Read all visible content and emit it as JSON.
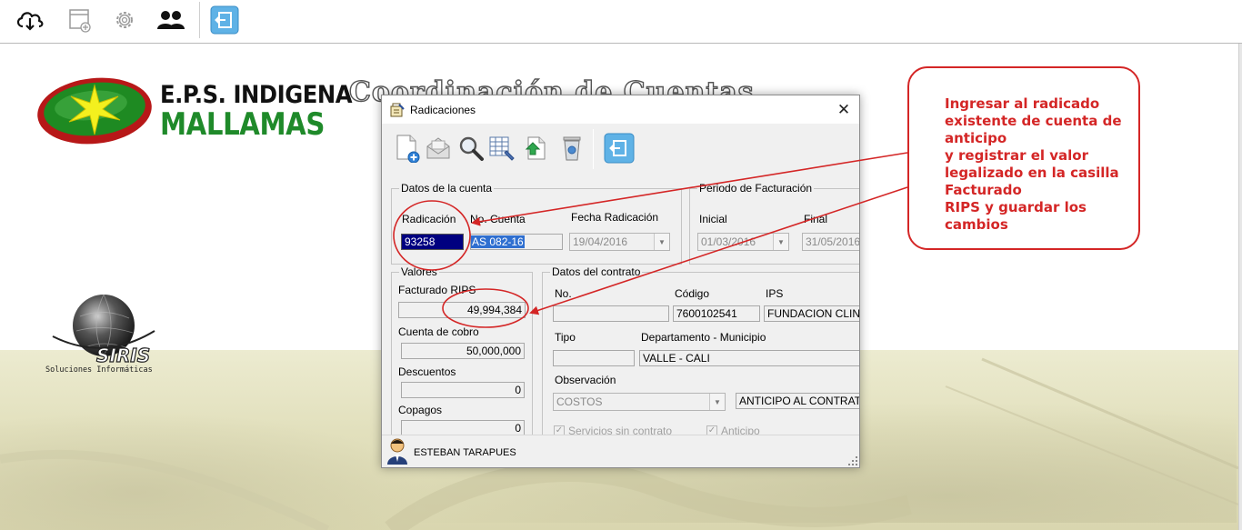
{
  "toolbar": {
    "buttons": [
      "cloud-download-icon",
      "new-window-icon",
      "settings-icon",
      "users-icon",
      "exit-icon"
    ]
  },
  "logo": {
    "line1": "E.P.S. INDIGENA",
    "line2": "MALLAMAS"
  },
  "background_title": "Coordinación de Cuentas",
  "siris": {
    "name": "SIRIS",
    "tagline": "Soluciones Informáticas"
  },
  "dialog": {
    "title": "Radicaciones",
    "close_label": "✕",
    "toolbar_icons": [
      "new-document-icon",
      "open-mail-icon",
      "search-icon",
      "grid-edit-icon",
      "export-icon",
      "delete-icon",
      "exit-icon"
    ],
    "datos_cuenta": {
      "group_label": "Datos de la cuenta",
      "radicacion_label": "Radicación",
      "radicacion_value": "93258",
      "no_cuenta_label": "No. Cuenta",
      "no_cuenta_value": "AS 082-16",
      "fecha_label": "Fecha Radicación",
      "fecha_value": "19/04/2016"
    },
    "periodo": {
      "group_label": "Periodo de Facturación",
      "inicial_label": "Inicial",
      "inicial_value": "01/03/2016",
      "final_label": "Final",
      "final_value": "31/05/2016"
    },
    "valores": {
      "group_label": "Valores",
      "facturado_label": "Facturado RIPS",
      "facturado_value": "49,994,384",
      "cuenta_cobro_label": "Cuenta de cobro",
      "cuenta_cobro_value": "50,000,000",
      "descuentos_label": "Descuentos",
      "descuentos_value": "0",
      "copagos_label": "Copagos",
      "copagos_value": "0"
    },
    "contrato": {
      "group_label": "Datos del contrato",
      "no_label": "No.",
      "no_value": "",
      "codigo_label": "Código",
      "codigo_value": "7600102541",
      "ips_label": "IPS",
      "ips_value": "FUNDACION CLINICA",
      "tipo_label": "Tipo",
      "tipo_value": "",
      "depto_label": "Departamento - Municipio",
      "depto_value": "VALLE - CALI",
      "observacion_label": "Observación",
      "observacion_combo": "COSTOS",
      "observacion_value": "ANTICIPO AL CONTRATO",
      "chk_servicios_label": "Servicios sin contrato",
      "chk_servicios_checked": true,
      "chk_anticipo_label": "Anticipo",
      "chk_anticipo_checked": true
    },
    "status_user": "ESTEBAN TARAPUES"
  },
  "annotation": {
    "lines": [
      "Ingresar al radicado",
      "existente de cuenta de",
      "anticipo",
      "y registrar el valor",
      "legalizado en la casilla",
      "Facturado",
      "RIPS y guardar los",
      "cambios"
    ],
    "color": "#d42626"
  }
}
